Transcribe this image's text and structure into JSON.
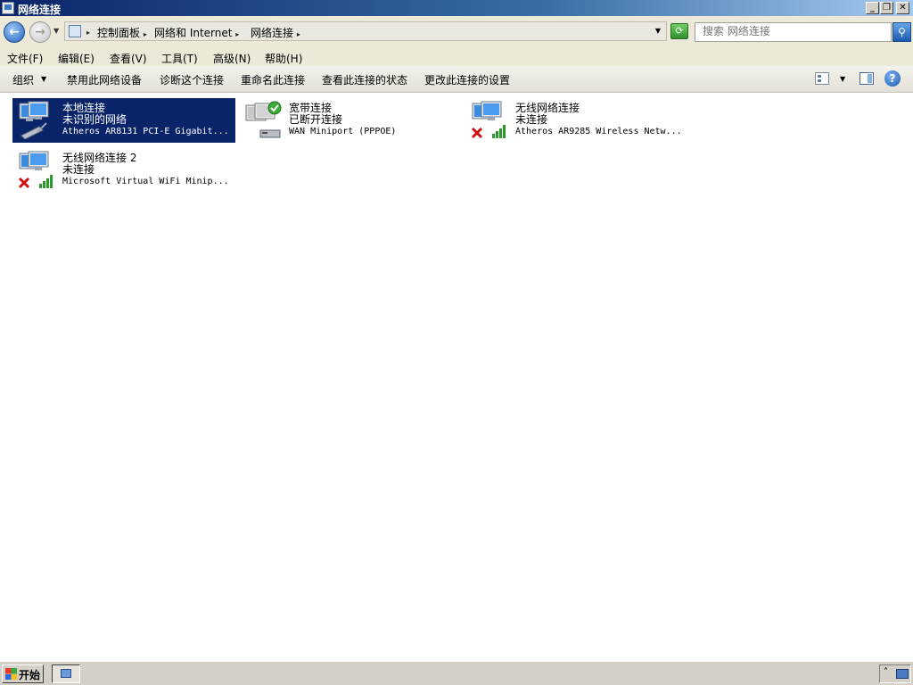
{
  "window": {
    "title": "网络连接"
  },
  "address": {
    "crumbs": [
      "控制面板",
      "网络和 Internet",
      "网络连接"
    ]
  },
  "search": {
    "placeholder": "搜索 网络连接"
  },
  "menu": {
    "items": [
      "文件(F)",
      "编辑(E)",
      "查看(V)",
      "工具(T)",
      "高级(N)",
      "帮助(H)"
    ]
  },
  "toolbar": {
    "organize": "组织",
    "disable": "禁用此网络设备",
    "diagnose": "诊断这个连接",
    "rename": "重命名此连接",
    "status": "查看此连接的状态",
    "settings": "更改此连接的设置"
  },
  "connections": [
    {
      "name": "本地连接",
      "status": "未识别的网络",
      "device": "Atheros AR8131 PCI-E Gigabit...",
      "type": "wired",
      "selected": true
    },
    {
      "name": "宽带连接",
      "status": "已断开连接",
      "device": "WAN Miniport (PPPOE)",
      "type": "broadband",
      "selected": false
    },
    {
      "name": "无线网络连接",
      "status": "未连接",
      "device": "Atheros AR9285 Wireless Netw...",
      "type": "wireless-disconnected",
      "selected": false
    },
    {
      "name": "无线网络连接 2",
      "status": "未连接",
      "device": "Microsoft Virtual WiFi Minip...",
      "type": "wireless-disconnected",
      "selected": false
    }
  ],
  "taskbar": {
    "start": "开始"
  },
  "colors": {
    "selection": "#0a246a",
    "chrome": "#ece9d8",
    "error": "#d01010",
    "signal": "#2a9a2a"
  }
}
